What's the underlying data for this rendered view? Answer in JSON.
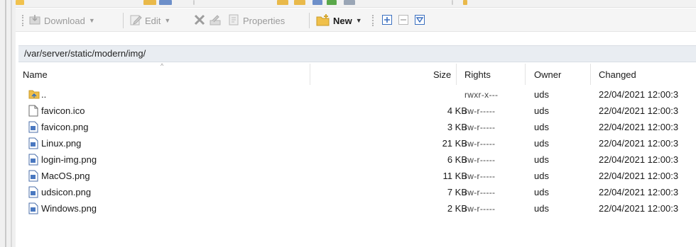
{
  "toolbar": {
    "download_label": "Download",
    "edit_label": "Edit",
    "properties_label": "Properties",
    "new_label": "New"
  },
  "path": "/var/server/static/modern/img/",
  "columns": {
    "name": "Name",
    "size": "Size",
    "rights": "Rights",
    "owner": "Owner",
    "changed": "Changed"
  },
  "rows": [
    {
      "name": "..",
      "size": "",
      "rights": "rwxr-x---",
      "owner": "uds",
      "changed": "22/04/2021 12:00:3",
      "icon": "parent-folder-icon"
    },
    {
      "name": "favicon.ico",
      "size": "4 KB",
      "rights": "rw-r-----",
      "owner": "uds",
      "changed": "22/04/2021 12:00:3",
      "icon": "file-icon"
    },
    {
      "name": "favicon.png",
      "size": "3 KB",
      "rights": "rw-r-----",
      "owner": "uds",
      "changed": "22/04/2021 12:00:3",
      "icon": "image-file-icon"
    },
    {
      "name": "Linux.png",
      "size": "21 KB",
      "rights": "rw-r-----",
      "owner": "uds",
      "changed": "22/04/2021 12:00:3",
      "icon": "image-file-icon"
    },
    {
      "name": "login-img.png",
      "size": "6 KB",
      "rights": "rw-r-----",
      "owner": "uds",
      "changed": "22/04/2021 12:00:3",
      "icon": "image-file-icon"
    },
    {
      "name": "MacOS.png",
      "size": "11 KB",
      "rights": "rw-r-----",
      "owner": "uds",
      "changed": "22/04/2021 12:00:3",
      "icon": "image-file-icon"
    },
    {
      "name": "udsicon.png",
      "size": "7 KB",
      "rights": "rw-r-----",
      "owner": "uds",
      "changed": "22/04/2021 12:00:3",
      "icon": "image-file-icon"
    },
    {
      "name": "Windows.png",
      "size": "2 KB",
      "rights": "rw-r-----",
      "owner": "uds",
      "changed": "22/04/2021 12:00:3",
      "icon": "image-file-icon"
    }
  ],
  "colors": {
    "accent": "#2b6cc4",
    "folder": "#e8b84a",
    "path_bg": "#e9edf2"
  }
}
